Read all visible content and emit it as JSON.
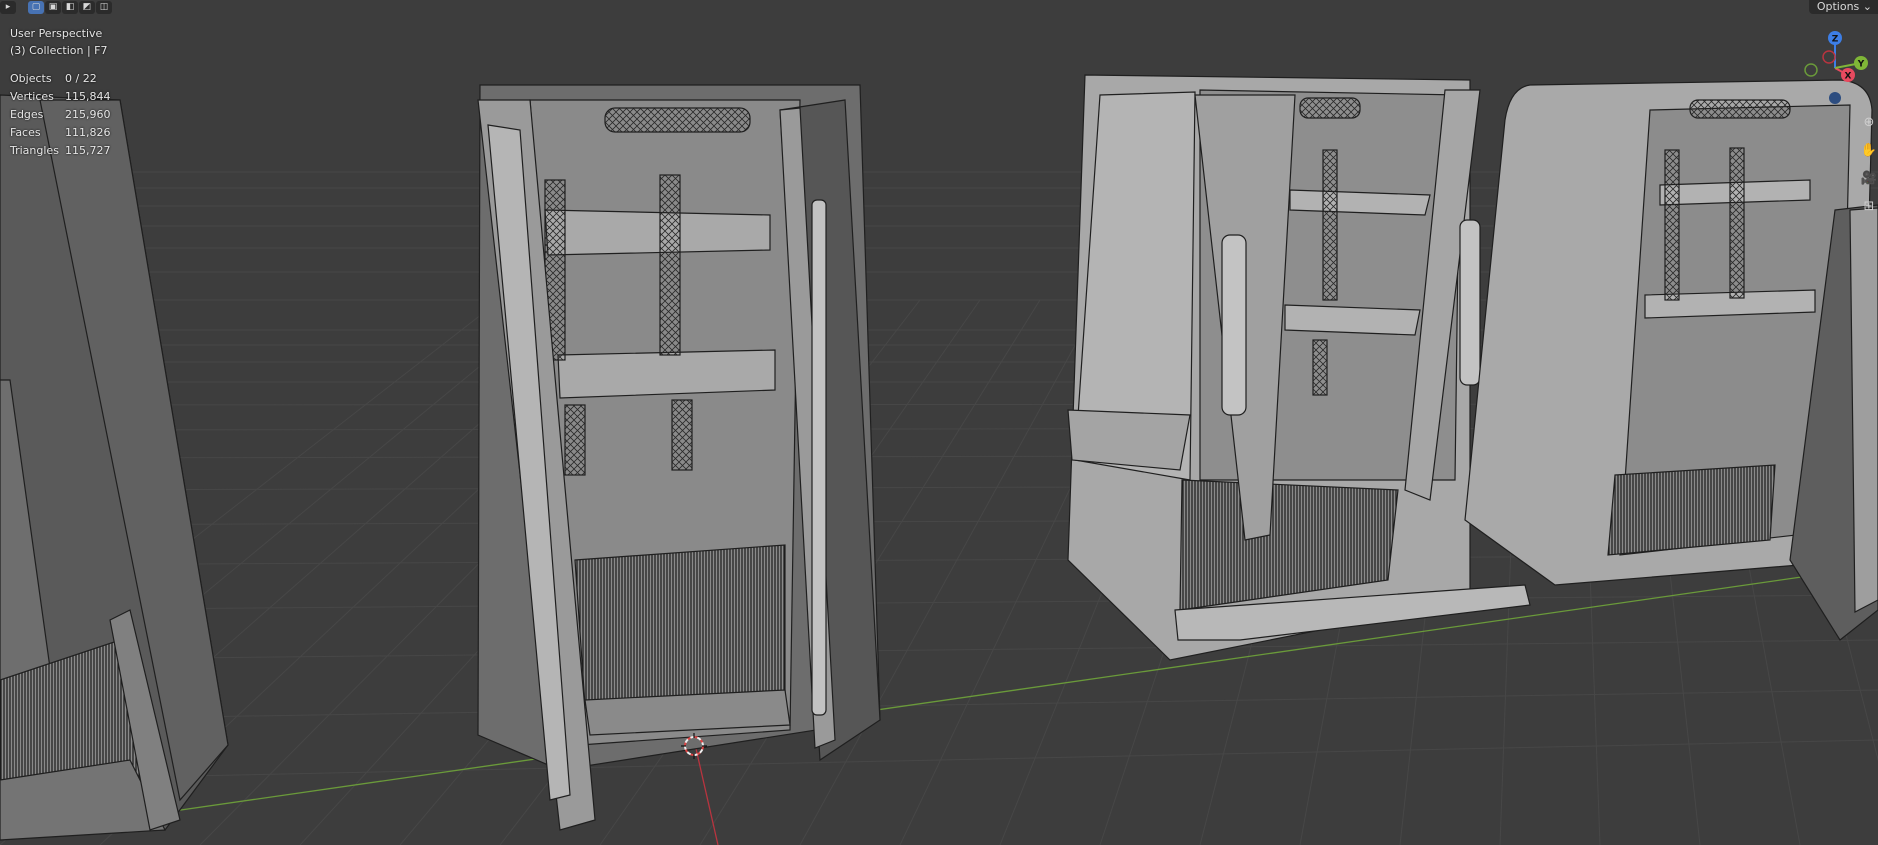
{
  "viewport": {
    "view_name": "User Perspective",
    "collection_info": "(3) Collection | F7",
    "stats": [
      {
        "label": "Objects",
        "value": "0 / 22"
      },
      {
        "label": "Vertices",
        "value": "115,844"
      },
      {
        "label": "Edges",
        "value": "215,960"
      },
      {
        "label": "Faces",
        "value": "111,826"
      },
      {
        "label": "Triangles",
        "value": "115,727"
      }
    ],
    "options_label": "Options",
    "options_chevron": "⌄"
  },
  "toolbar": {
    "icons": [
      "select-tool-icon",
      "select-box-icon",
      "select-extend-icon",
      "select-subtract-icon",
      "select-invert-icon",
      "select-intersect-icon"
    ]
  },
  "gizmo": {
    "z_label": "Z",
    "x_label": "X",
    "y_label": "Y",
    "colors": {
      "x": "#e84a5f",
      "y": "#7fb637",
      "z": "#3d7ee6"
    }
  },
  "navigation": {
    "icons": [
      "zoom-icon",
      "pan-hand-icon",
      "camera-icon",
      "grid-view-icon"
    ],
    "glyphs": [
      "⊕",
      "✋",
      "🎥",
      "⊞"
    ]
  },
  "scene": {
    "background": "#3d3d3d",
    "grid_color": "#4a4a4a",
    "x_axis_color": "#8a3a42",
    "y_axis_color": "#6a9a3a",
    "object_fill": "#7d7d7d",
    "object_edge": "#1f1f1f",
    "objects": [
      "refrigerator-left-partial",
      "refrigerator-open-center",
      "refrigerator-french-door",
      "refrigerator-rounded-right"
    ]
  }
}
